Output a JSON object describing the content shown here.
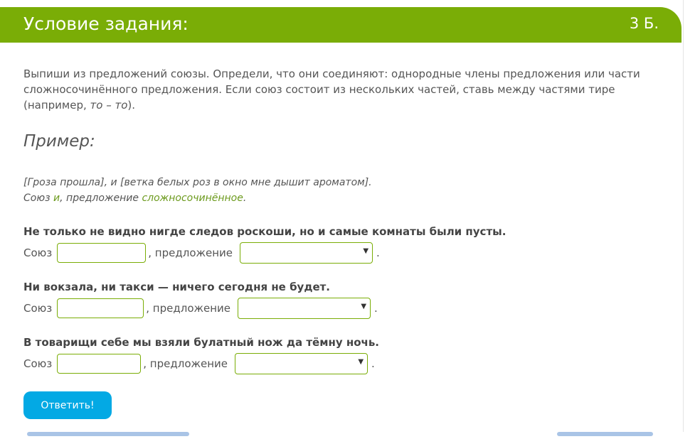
{
  "header": {
    "title": "Условие задания:",
    "points": "3 Б.",
    "color": "#7aad06"
  },
  "instructions": {
    "text_main": "Выпиши из предложений союзы. Определи, что они соединяют: однородные члены предложения или части сложносочинённого предложения. Если союз состоит из нескольких частей, ставь между частями тире (например, ",
    "example_word": "то – то",
    "text_end": ")."
  },
  "example": {
    "heading": "Пример:",
    "sentence": "[Гроза прошла], и [ветка белых роз в окно мне дышит ароматом].",
    "answer_prefix": "Союз ",
    "answer_conj": "и",
    "answer_middle": ", предложение ",
    "answer_type": "сложносочинённое",
    "answer_end": "."
  },
  "questions": [
    {
      "sentence": "Не только не видно нигде следов роскоши, но и самые комнаты были пусты.",
      "label_union": "Союз",
      "union_value": "",
      "label_sentence": ", предложение",
      "select_value": "",
      "end": "."
    },
    {
      "sentence": "Ни вокзала, ни такси — ничего сегодня не будет.",
      "label_union": "Союз",
      "union_value": "",
      "label_sentence": ", предложение",
      "select_value": "",
      "end": "."
    },
    {
      "sentence": "В товарищи себе мы взяли булатный нож да тёмну ночь.",
      "label_union": "Союз",
      "union_value": "",
      "label_sentence": ", предложение",
      "select_value": "",
      "end": "."
    }
  ],
  "submit": {
    "label": "Ответить!",
    "color": "#03a9e4"
  },
  "icons": {
    "select_caret": "▼"
  }
}
